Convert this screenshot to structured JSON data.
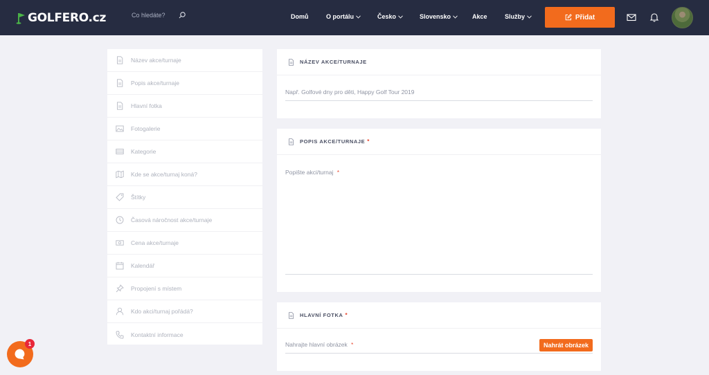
{
  "header": {
    "logo_text": "GOLFERO.cz",
    "search_placeholder": "Co hledáte?",
    "nav": [
      {
        "label": "Domů"
      },
      {
        "label": "O portálu"
      },
      {
        "label": "Česko"
      },
      {
        "label": "Slovensko"
      },
      {
        "label": "Akce"
      },
      {
        "label": "Služby"
      }
    ],
    "add_label": "Přidat",
    "brand_color": "#f26b1d",
    "header_bg": "#262c41"
  },
  "sidebar": {
    "items": [
      {
        "label": "Název akce/turnaje",
        "icon": "document-icon"
      },
      {
        "label": "Popis akce/turnaje",
        "icon": "document-icon"
      },
      {
        "label": "Hlavní fotka",
        "icon": "document-icon"
      },
      {
        "label": "Fotogalerie",
        "icon": "image-icon"
      },
      {
        "label": "Kategorie",
        "icon": "list-icon"
      },
      {
        "label": "Kde se akce/turnaj koná?",
        "icon": "map-icon"
      },
      {
        "label": "Štítky",
        "icon": "tag-icon"
      },
      {
        "label": "Časová náročnost akce/turnaje",
        "icon": "clock-icon"
      },
      {
        "label": "Cena akce/turnaje",
        "icon": "money-icon"
      },
      {
        "label": "Kalendář",
        "icon": "calendar-icon"
      },
      {
        "label": "Propojení s místem",
        "icon": "pin-icon"
      },
      {
        "label": "Kdo akci/turnaj pořádá?",
        "icon": "user-icon"
      },
      {
        "label": "Kontaktní informace",
        "icon": "phone-icon"
      }
    ]
  },
  "cards": {
    "name": {
      "title": "Název akce/turnaje",
      "placeholder": "Např. Golfové dny pro děti, Happy Golf Tour 2019"
    },
    "description": {
      "title": "Popis akce/turnaje",
      "required_mark": "*",
      "placeholder": "Popište akci/turnaj",
      "placeholder_required": "*"
    },
    "photo": {
      "title": "Hlavní fotka",
      "required_mark": "*",
      "placeholder": "Nahrajte hlavní obrázek",
      "placeholder_required": "*",
      "upload_label": "Nahrát obrázek"
    }
  },
  "chat": {
    "badge_count": "1"
  }
}
